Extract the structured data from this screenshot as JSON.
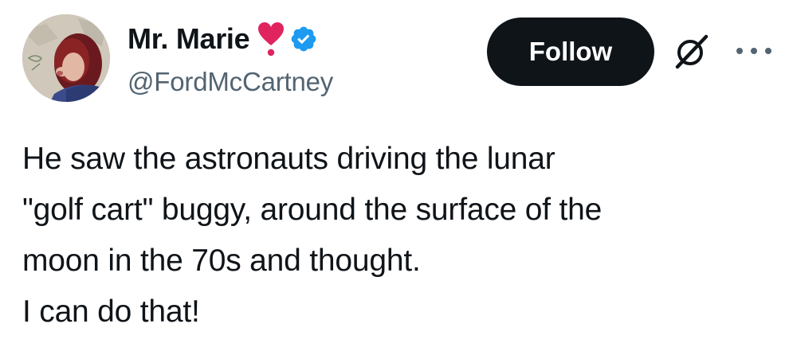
{
  "author": {
    "display_name": "Mr. Marie",
    "name_emoji": "heart-exclamation-emoji",
    "verified": true,
    "handle": "@FordMcCartney",
    "avatar": "profile-photo-avatar"
  },
  "actions": {
    "follow_label": "Follow",
    "grok_icon": "grok-icon",
    "more_icon": "more-options-icon"
  },
  "tweet": {
    "lines": [
      "He saw the astronauts driving the lunar",
      "\"golf cart\" buggy, around the surface of the",
      "moon in the 70s and thought.",
      "I can do that!"
    ]
  },
  "colors": {
    "text_primary": "#0f1419",
    "text_secondary": "#536471",
    "verified_blue": "#1d9bf0",
    "heart_red": "#e0245e",
    "follow_bg": "#0f1419",
    "follow_text": "#ffffff"
  }
}
